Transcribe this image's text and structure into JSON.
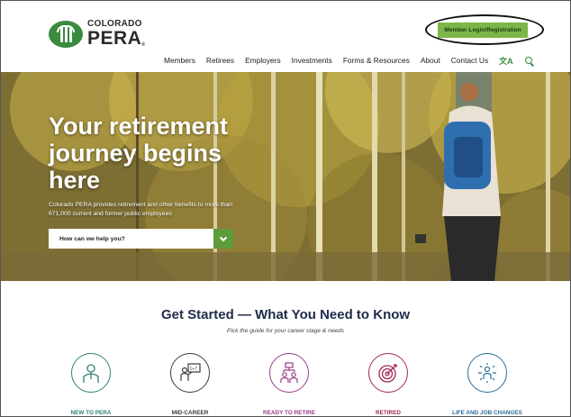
{
  "brand": {
    "line1": "COLORADO",
    "line2": "PERA",
    "reg": "®"
  },
  "header": {
    "login_label": "Member Login/Registration"
  },
  "nav": {
    "items": [
      "Members",
      "Retirees",
      "Employers",
      "Investments",
      "Forms & Resources",
      "About",
      "Contact Us"
    ],
    "language_icon": "translate-icon",
    "search_icon": "search-icon"
  },
  "hero": {
    "title": "Your retirement journey begins here",
    "subtitle": "Colorado PERA provides retirement and other benefits to more than 671,000 current and former public employees",
    "help_label": "How can we help you?"
  },
  "get_started": {
    "title": "Get Started — What You Need to Know",
    "subtitle": "Pick the guide for your career stage & needs",
    "stages": [
      {
        "label": "NEW TO PERA",
        "icon": "new-employee-icon",
        "color": "#2e7f76"
      },
      {
        "label": "MID-CAREER",
        "icon": "mid-career-icon",
        "color": "#3b3b3b"
      },
      {
        "label": "READY TO RETIRE",
        "icon": "ready-to-retire-icon",
        "color": "#9a3c8a"
      },
      {
        "label": "RETIRED",
        "icon": "retired-target-icon",
        "color": "#a3285a"
      },
      {
        "label": "LIFE AND JOB CHANGES",
        "icon": "life-changes-icon",
        "color": "#2b6e9c"
      }
    ]
  },
  "colors": {
    "brand_green": "#3a8a3f",
    "login_green": "#7ab648",
    "navy": "#1e2b4a"
  }
}
